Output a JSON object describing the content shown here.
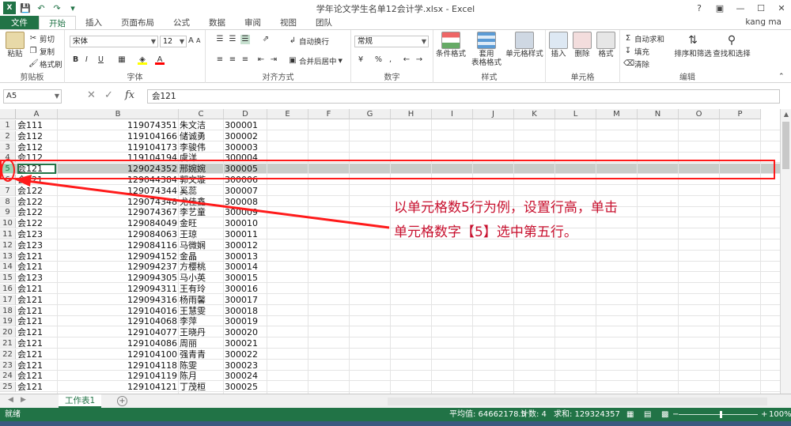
{
  "window": {
    "title": "学年论文学生名单12会计学.xlsx - Excel",
    "user": "kang ma",
    "controls": [
      "?",
      "▣",
      "—",
      "☐",
      "✕"
    ]
  },
  "tabs": [
    {
      "label": "文件"
    },
    {
      "label": "开始"
    },
    {
      "label": "插入"
    },
    {
      "label": "页面布局"
    },
    {
      "label": "公式"
    },
    {
      "label": "数据"
    },
    {
      "label": "审阅"
    },
    {
      "label": "视图"
    },
    {
      "label": "团队"
    }
  ],
  "ribbon": {
    "clipboard": {
      "label": "剪贴板",
      "paste": "粘贴",
      "cut": "剪切",
      "copy": "复制",
      "format_painter": "格式刷"
    },
    "font": {
      "label": "字体",
      "name": "宋体",
      "size": "12",
      "bold": "B",
      "italic": "I",
      "underline": "U",
      "grow": "A",
      "shrink": "A",
      "font_color": "A"
    },
    "alignment": {
      "label": "对齐方式",
      "wrap": "自动换行",
      "merge": "合并后居中"
    },
    "number": {
      "label": "数字",
      "format": "常规",
      "percent": "%",
      "comma": ","
    },
    "styles": {
      "label": "样式",
      "conditional": "条件格式",
      "table_format_1": "套用",
      "table_format_2": "表格格式",
      "cell_styles": "单元格样式"
    },
    "cells": {
      "label": "单元格",
      "insert": "插入",
      "delete": "删除",
      "format": "格式"
    },
    "editing": {
      "label": "编辑",
      "autosum": "自动求和",
      "fill": "填充",
      "clear": "清除",
      "sort": "排序和筛选",
      "find": "查找和选择"
    }
  },
  "formula_bar": {
    "name_box": "A5",
    "fx": "fx",
    "content": "会121"
  },
  "columns": [
    "A",
    "B",
    "C",
    "D",
    "E",
    "F",
    "G",
    "H",
    "I",
    "J",
    "K",
    "L",
    "M",
    "N",
    "O",
    "P"
  ],
  "rows": [
    {
      "n": "1",
      "a": "会111",
      "b": "119074351",
      "c": "朱文洁",
      "d": "300001"
    },
    {
      "n": "2",
      "a": "会112",
      "b": "119104166",
      "c": "储诚勇",
      "d": "300002"
    },
    {
      "n": "3",
      "a": "会112",
      "b": "119104173",
      "c": "李骏伟",
      "d": "300003"
    },
    {
      "n": "4",
      "a": "会112",
      "b": "119104194",
      "c": "虞洋",
      "d": "300004"
    },
    {
      "n": "5",
      "a": "会121",
      "b": "129024352",
      "c": "邢婉婉",
      "d": "300005"
    },
    {
      "n": "6",
      "a": "会121",
      "b": "129044384",
      "c": "郭文璇",
      "d": "300006"
    },
    {
      "n": "7",
      "a": "会122",
      "b": "129074344",
      "c": "奚蕊",
      "d": "300007"
    },
    {
      "n": "8",
      "a": "会122",
      "b": "129074348",
      "c": "尤佳鑫",
      "d": "300008"
    },
    {
      "n": "9",
      "a": "会122",
      "b": "129074367",
      "c": "李艺童",
      "d": "300009"
    },
    {
      "n": "10",
      "a": "会122",
      "b": "129084049",
      "c": "金旺",
      "d": "300010"
    },
    {
      "n": "11",
      "a": "会123",
      "b": "129084063",
      "c": "王琼",
      "d": "300011"
    },
    {
      "n": "12",
      "a": "会123",
      "b": "129084116",
      "c": "马微娴",
      "d": "300012"
    },
    {
      "n": "13",
      "a": "会121",
      "b": "129094152",
      "c": "金晶",
      "d": "300013"
    },
    {
      "n": "14",
      "a": "会121",
      "b": "129094237",
      "c": "方樱桃",
      "d": "300014"
    },
    {
      "n": "15",
      "a": "会123",
      "b": "129094305",
      "c": "马小英",
      "d": "300015"
    },
    {
      "n": "16",
      "a": "会121",
      "b": "129094311",
      "c": "王有玲",
      "d": "300016"
    },
    {
      "n": "17",
      "a": "会121",
      "b": "129094316",
      "c": "杨雨馨",
      "d": "300017"
    },
    {
      "n": "18",
      "a": "会121",
      "b": "129104016",
      "c": "王慧雯",
      "d": "300018"
    },
    {
      "n": "19",
      "a": "会121",
      "b": "129104068",
      "c": "李萍",
      "d": "300019"
    },
    {
      "n": "20",
      "a": "会121",
      "b": "129104077",
      "c": "王晓丹",
      "d": "300020"
    },
    {
      "n": "21",
      "a": "会121",
      "b": "129104086",
      "c": "周丽",
      "d": "300021"
    },
    {
      "n": "22",
      "a": "会121",
      "b": "129104100",
      "c": "强青青",
      "d": "300022"
    },
    {
      "n": "23",
      "a": "会121",
      "b": "129104118",
      "c": "陈雯",
      "d": "300023"
    },
    {
      "n": "24",
      "a": "会121",
      "b": "129104119",
      "c": "陈月",
      "d": "300024"
    },
    {
      "n": "25",
      "a": "会121",
      "b": "129104121",
      "c": "丁茂桓",
      "d": "300025"
    }
  ],
  "selected_row": "5",
  "annotation": {
    "line1": "以单元格数5行为例，设置行高，单击",
    "line2": "单元格数字【5】选中第五行。"
  },
  "sheet": {
    "tab": "工作表1",
    "add": "+"
  },
  "status": {
    "ready": "就绪",
    "average": "平均值: 64662178.5",
    "count": "计数: 4",
    "sum": "求和: 129324357",
    "zoom": "100%"
  },
  "colors": {
    "accent": "#217346",
    "annotation": "#ff1a1a",
    "annotation_text": "#c8102e"
  }
}
